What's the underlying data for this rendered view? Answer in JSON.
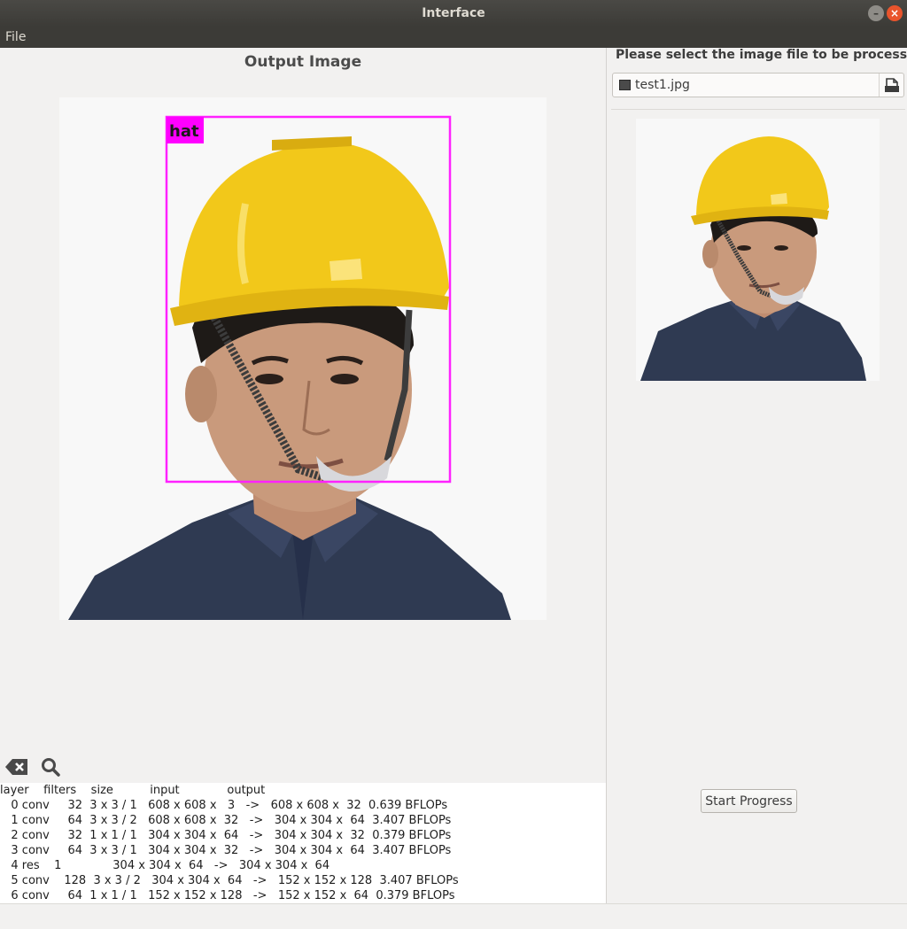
{
  "window": {
    "title": "Interface"
  },
  "menu": {
    "file": "File"
  },
  "output": {
    "title": "Output Image",
    "detection_label": "hat",
    "detection_color": "#ff00ff"
  },
  "log": {
    "lines": [
      "layer    filters    size          input             output",
      "   0 conv     32  3 x 3 / 1   608 x 608 x   3   ->   608 x 608 x  32  0.639 BFLOPs",
      "   1 conv     64  3 x 3 / 2   608 x 608 x  32   ->   304 x 304 x  64  3.407 BFLOPs",
      "   2 conv     32  1 x 1 / 1   304 x 304 x  64   ->   304 x 304 x  32  0.379 BFLOPs",
      "   3 conv     64  3 x 3 / 1   304 x 304 x  32   ->   304 x 304 x  64  3.407 BFLOPs",
      "   4 res    1              304 x 304 x  64   ->   304 x 304 x  64",
      "   5 conv    128  3 x 3 / 2   304 x 304 x  64   ->   152 x 152 x 128  3.407 BFLOPs",
      "   6 conv     64  1 x 1 / 1   152 x 152 x 128   ->   152 x 152 x  64  0.379 BFLOPs"
    ],
    "clear_icon": "clear-backspace-icon",
    "search_icon": "search-icon"
  },
  "sidebar": {
    "prompt": "Please select the image file to be processed!",
    "file_name": "test1.jpg",
    "start_button": "Start Progress"
  },
  "colors": {
    "helmet": "#f2c81a",
    "shirt": "#2e3a52",
    "skin": "#c99a7c"
  }
}
